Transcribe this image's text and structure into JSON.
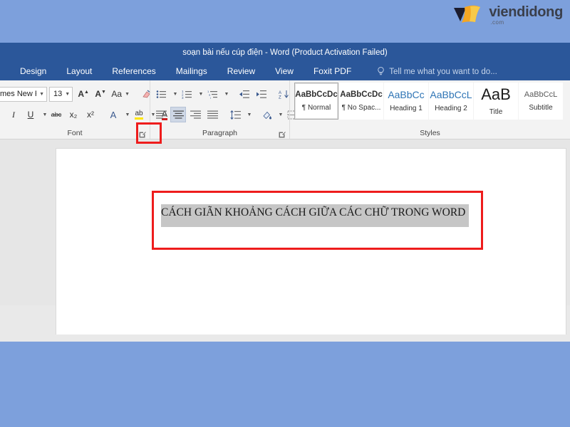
{
  "brand": {
    "name": "viendidong",
    "suffix": ".com",
    "logo_icon": "viendidong-logo",
    "colors": {
      "page_bg": "#7da0dc",
      "ribbon": "#2b579a",
      "accent_red": "#ee1c1c"
    }
  },
  "window": {
    "title": "soạn bài nếu cúp điện - Word (Product Activation Failed)"
  },
  "tabs": [
    {
      "label": "Design"
    },
    {
      "label": "Layout"
    },
    {
      "label": "References"
    },
    {
      "label": "Mailings"
    },
    {
      "label": "Review"
    },
    {
      "label": "View"
    },
    {
      "label": "Foxit PDF"
    }
  ],
  "tell_me": {
    "label": "Tell me what you want to do...",
    "icon": "lightbulb-icon"
  },
  "ribbon": {
    "font_group": {
      "label": "Font",
      "font_name": "mes New Ro",
      "font_size": "13",
      "buttons": [
        {
          "name": "grow-font",
          "glyph": "A"
        },
        {
          "name": "shrink-font",
          "glyph": "A"
        },
        {
          "name": "change-case",
          "glyph": "Aa"
        },
        {
          "name": "clear-formatting",
          "glyph": "✐"
        },
        {
          "name": "italic",
          "glyph": "I"
        },
        {
          "name": "underline",
          "glyph": "U"
        },
        {
          "name": "strikethrough",
          "glyph": "abc"
        },
        {
          "name": "subscript",
          "glyph": "x₂"
        },
        {
          "name": "superscript",
          "glyph": "x²"
        },
        {
          "name": "text-effects",
          "glyph": "A"
        },
        {
          "name": "text-highlight-color",
          "glyph": "ab"
        },
        {
          "name": "font-color",
          "glyph": "A"
        }
      ],
      "launcher": "font-dialog-launcher"
    },
    "paragraph_group": {
      "label": "Paragraph",
      "buttons": [
        {
          "name": "bullets",
          "glyph": "≔"
        },
        {
          "name": "numbering",
          "glyph": "≕"
        },
        {
          "name": "multilevel-list",
          "glyph": "≖"
        },
        {
          "name": "decrease-indent",
          "glyph": "⇤"
        },
        {
          "name": "increase-indent",
          "glyph": "⇥"
        },
        {
          "name": "sort",
          "glyph": "A↓"
        },
        {
          "name": "show-formatting-marks",
          "glyph": "¶"
        },
        {
          "name": "align-left",
          "glyph": "≡"
        },
        {
          "name": "align-center",
          "glyph": "≡"
        },
        {
          "name": "align-right",
          "glyph": "≡"
        },
        {
          "name": "justify",
          "glyph": "≡"
        },
        {
          "name": "line-spacing",
          "glyph": "↕"
        },
        {
          "name": "shading",
          "glyph": "▨"
        },
        {
          "name": "borders",
          "glyph": "⊞"
        }
      ],
      "active": "align-center",
      "launcher": "paragraph-dialog-launcher"
    },
    "styles_group": {
      "label": "Styles",
      "items": [
        {
          "preview": "AaBbCcDc",
          "name": "¶ Normal",
          "selected": true
        },
        {
          "preview": "AaBbCcDc",
          "name": "¶ No Spac...",
          "selected": false
        },
        {
          "preview": "AaBbCc",
          "name": "Heading 1",
          "selected": false
        },
        {
          "preview": "AaBbCcL",
          "name": "Heading 2",
          "selected": false
        },
        {
          "preview": "AaB",
          "name": "Title",
          "selected": false
        },
        {
          "preview": "AaBbCcL",
          "name": "Subtitle",
          "selected": false
        }
      ]
    }
  },
  "document": {
    "selected_text": "CÁCH GIÃN KHOẢNG CÁCH GIỮA CÁC CHỮ TRONG WORD"
  },
  "annotations": [
    {
      "name": "font-launcher-highlight"
    },
    {
      "name": "document-text-highlight"
    }
  ]
}
